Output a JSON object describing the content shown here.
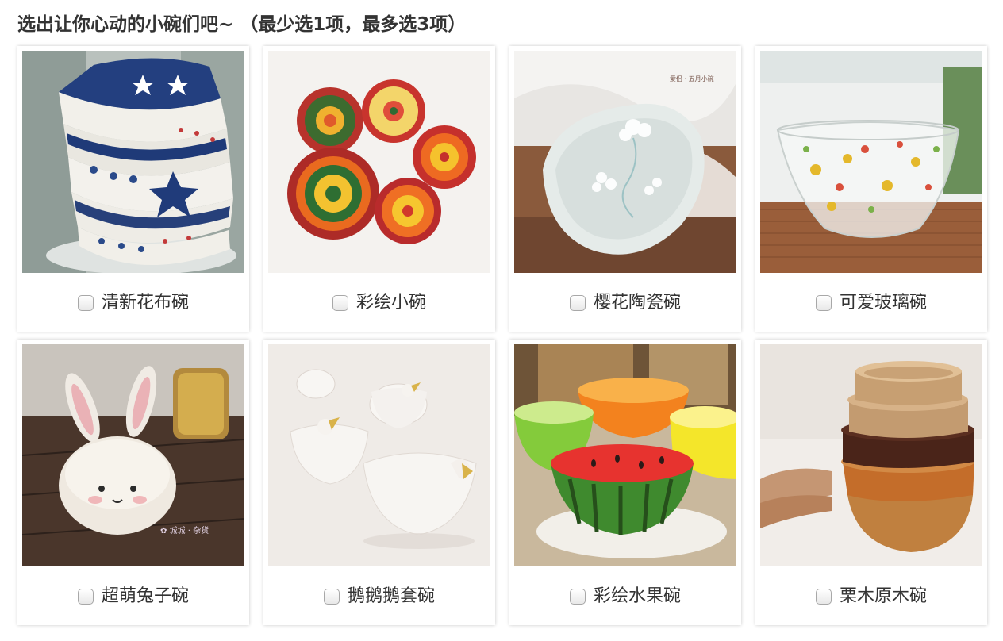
{
  "question": {
    "title": "选出让你心动的小碗们吧~ （最少选1项，最多选3项）",
    "min_select": 1,
    "max_select": 3
  },
  "options": [
    {
      "label": "清新花布碗",
      "checked": false,
      "image": "stacked-blue-white-bowls"
    },
    {
      "label": "彩绘小碗",
      "checked": false,
      "image": "painted-sun-bowls"
    },
    {
      "label": "樱花陶瓷碗",
      "checked": false,
      "image": "sakura-ceramic-bowl"
    },
    {
      "label": "可爱玻璃碗",
      "checked": false,
      "image": "cute-glass-bowl"
    },
    {
      "label": "超萌兔子碗",
      "checked": false,
      "image": "rabbit-ear-bowl"
    },
    {
      "label": "鹅鹅鹅套碗",
      "checked": false,
      "image": "goose-nesting-bowls"
    },
    {
      "label": "彩绘水果碗",
      "checked": false,
      "image": "fruit-painted-bowls"
    },
    {
      "label": "栗木原木碗",
      "checked": false,
      "image": "stacked-wooden-bowls"
    }
  ],
  "colors": {
    "title_text": "#333333",
    "card_background": "#ffffff",
    "checkbox_border": "#a8a8a8"
  }
}
